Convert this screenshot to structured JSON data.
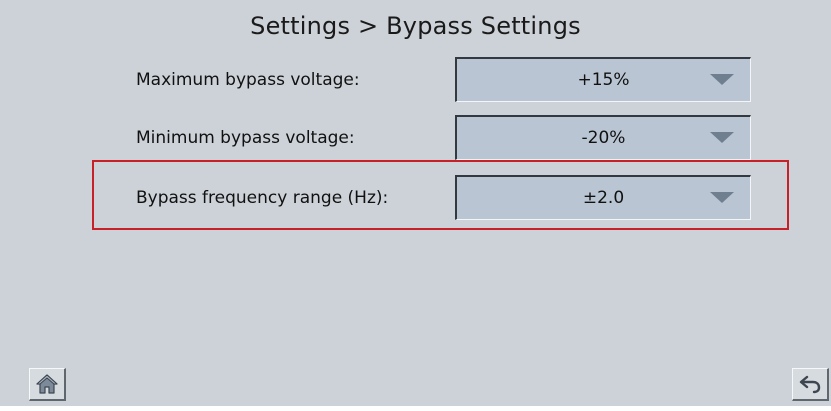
{
  "page": {
    "title": "Settings > Bypass Settings"
  },
  "settings": [
    {
      "label": "Maximum bypass voltage:",
      "value": "+15%"
    },
    {
      "label": "Minimum bypass voltage:",
      "value": "-20%"
    },
    {
      "label": "Bypass frequency range (Hz):",
      "value": "±2.0"
    }
  ],
  "highlight": {
    "color": "#c82028"
  },
  "nav": {
    "home_icon": "home-icon",
    "back_icon": "back-arrow-icon"
  }
}
